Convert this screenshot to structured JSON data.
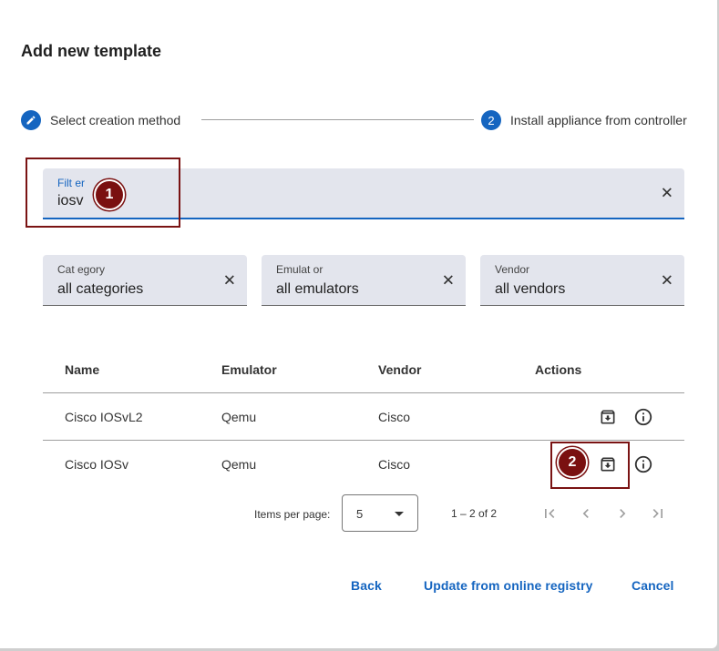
{
  "dialog": {
    "title": "Add new template"
  },
  "stepper": {
    "steps": [
      {
        "number": "",
        "label": "Select creation method",
        "icon": "pencil-icon"
      },
      {
        "number": "2",
        "label": "Install appliance from controller"
      }
    ]
  },
  "filter": {
    "label": "Filt er",
    "value": "iosv"
  },
  "category": {
    "label": "Cat egory",
    "value": "all categories"
  },
  "emulator": {
    "label": "Emulat or",
    "value": "all emulators"
  },
  "vendor": {
    "label": "Vendor",
    "value": "all vendors"
  },
  "annotations": {
    "badge_1": "1",
    "badge_2": "2",
    "color": "#7a1010"
  },
  "table": {
    "headers": [
      "Name",
      "Emulator",
      "Vendor",
      "Actions"
    ],
    "rows": [
      {
        "name": "Cisco IOSvL2",
        "emulator": "Qemu",
        "vendor": "Cisco"
      },
      {
        "name": "Cisco IOSv",
        "emulator": "Qemu",
        "vendor": "Cisco"
      }
    ]
  },
  "paginator": {
    "items_per_page_label": "Items per page:",
    "page_size": "5",
    "range_label": "1 – 2 of 2"
  },
  "footer": {
    "back": "Back",
    "update": "Update from online registry",
    "cancel": "Cancel"
  },
  "colors": {
    "accent": "#1565c0",
    "field_bg": "#e3e5ed"
  }
}
